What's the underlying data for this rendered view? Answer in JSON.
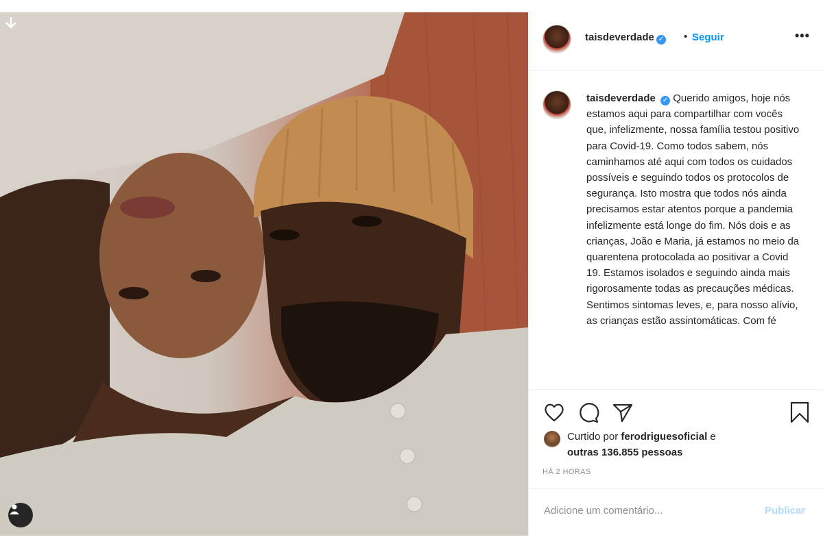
{
  "post": {
    "username": "taisdeverdade",
    "verified_symbol": "✓",
    "separator": "•",
    "follow_label": "Seguir",
    "more_label": "•••",
    "caption": "Querido amigos, hoje nós estamos aqui para compartilhar com vocês que, infelizmente, nossa família testou positivo para Covid-19. Como todos sabem, nós caminhamos até aqui com todos os cuidados possíveis e seguindo todos os protocolos de segurança. Isto mostra que todos nós ainda precisamos estar atentos porque a pandemia infelizmente está longe do fim. Nós dois e as crianças, João e Maria, já estamos no meio da quarentena protocolada ao positivar a Covid 19. Estamos isolados e seguindo ainda mais rigorosamente todas as precauções médicas. Sentimos sintomas leves, e, para nosso alívio, as crianças estão assintomáticas. Com fé"
  },
  "likes": {
    "prefix": "Curtido por",
    "liker": "ferodriguesoficial",
    "connector": "e",
    "others": "outras 136.855 pessoas"
  },
  "time_ago": "HÁ 2 HORAS",
  "comment": {
    "placeholder": "Adicione um comentário...",
    "publish_label": "Publicar"
  },
  "icons": {
    "download": "arrow-down-icon",
    "user_tag": "user-icon",
    "like": "heart-icon",
    "comment": "comment-icon",
    "share": "paper-plane-icon",
    "save": "bookmark-icon"
  },
  "colors": {
    "link_blue": "#0095f6",
    "publish_disabled": "#b3dbff",
    "muted": "#8e8e8e",
    "verified": "#3897f0"
  }
}
